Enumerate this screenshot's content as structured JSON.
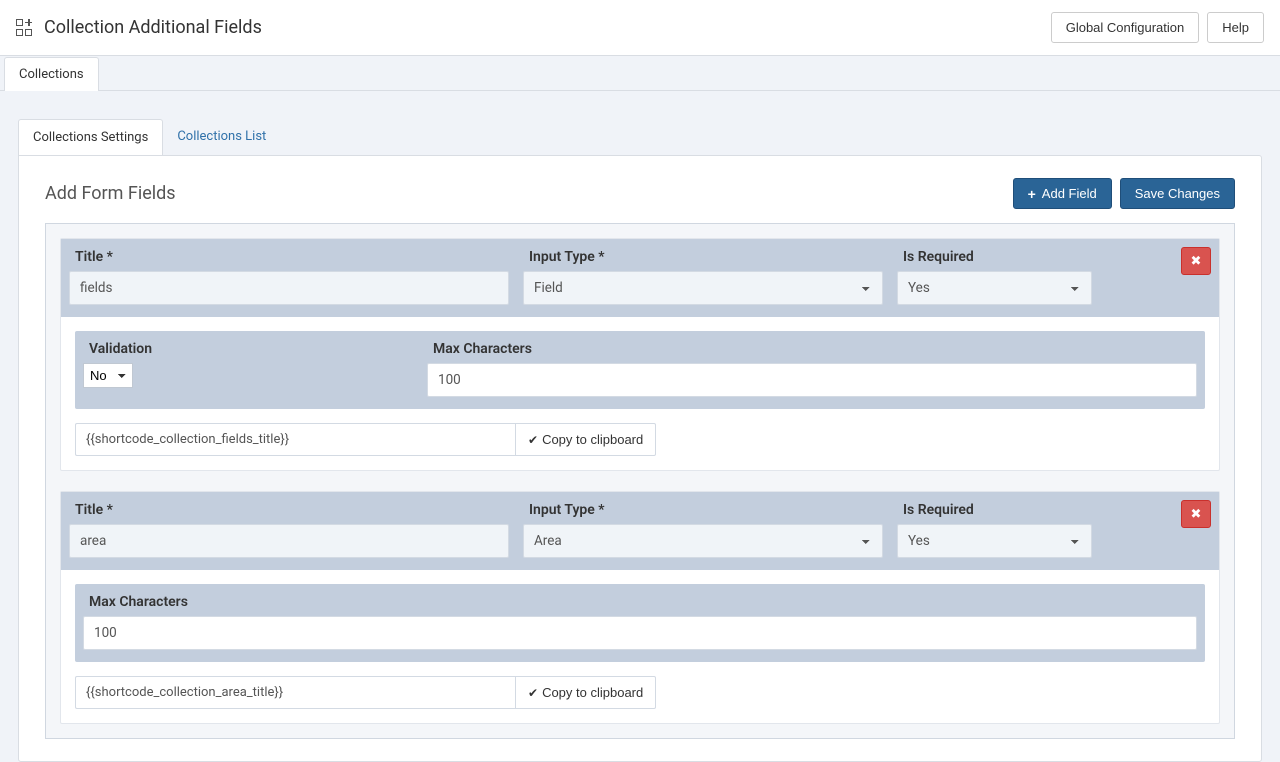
{
  "header": {
    "title": "Collection Additional Fields",
    "global_config": "Global Configuration",
    "help": "Help"
  },
  "subnav": {
    "tab": "Collections"
  },
  "tabs": {
    "settings": "Collections Settings",
    "list": "Collections List"
  },
  "panel": {
    "title": "Add Form Fields",
    "add_field": "Add Field",
    "save": "Save Changes"
  },
  "labels": {
    "title": "Title *",
    "input_type": "Input Type *",
    "required": "Is Required",
    "validation": "Validation",
    "max_chars": "Max Characters",
    "copy": "Copy to clipboard"
  },
  "fields": [
    {
      "title_value": "fields",
      "type_value": "Field",
      "required_value": "Yes",
      "has_validation": true,
      "validation_value": "No",
      "max_value": "100",
      "shortcode": "{{shortcode_collection_fields_title}}"
    },
    {
      "title_value": "area",
      "type_value": "Area",
      "required_value": "Yes",
      "has_validation": false,
      "max_value": "100",
      "shortcode": "{{shortcode_collection_area_title}}"
    }
  ]
}
